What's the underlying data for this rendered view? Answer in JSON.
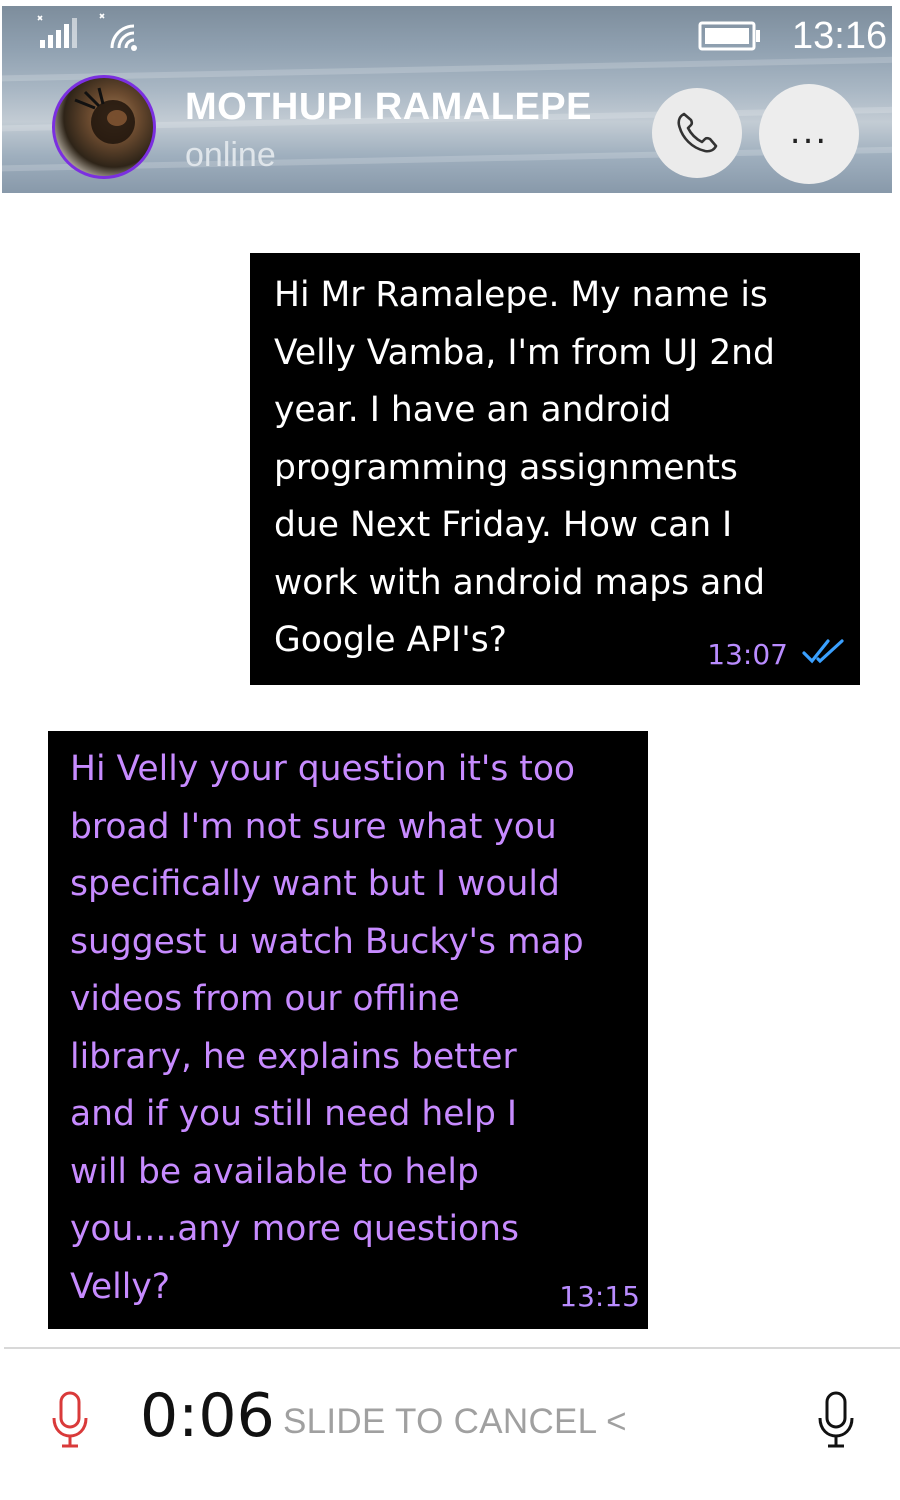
{
  "status_bar": {
    "time": "13:16",
    "icons": [
      "signal-icon",
      "wifi-icon",
      "battery-icon"
    ]
  },
  "header": {
    "contact_name": "MOTHUPI RAMALEPE",
    "contact_status": "online",
    "more_label": "...",
    "icons": [
      "avatar",
      "phone-icon"
    ]
  },
  "messages": [
    {
      "direction": "outgoing",
      "text": "Hi Mr Ramalepe. My name is\nVelly Vamba, I'm from UJ 2nd\nyear. I have an android\nprogramming assignments\ndue Next Friday. How can I\nwork with android maps and\nGoogle API's?",
      "time": "13:07",
      "status_icon": "double-check-icon"
    },
    {
      "direction": "incoming",
      "text": "Hi Velly your question it's too\nbroad I'm not sure what you\nspecifically want but I would\nsuggest u watch Bucky's map\nvideos from our offline\nlibrary, he explains better\nand if you still need help I\nwill be available to help\nyou....any more questions\nVelly?",
      "time": "13:15"
    }
  ],
  "recording": {
    "timer": "0:06",
    "slide_to_cancel": "SLIDE TO CANCEL <",
    "colors": {
      "recording_mic": "#d93a3a",
      "accent": "#7b2fe0",
      "incoming_text": "#c78bff"
    }
  }
}
